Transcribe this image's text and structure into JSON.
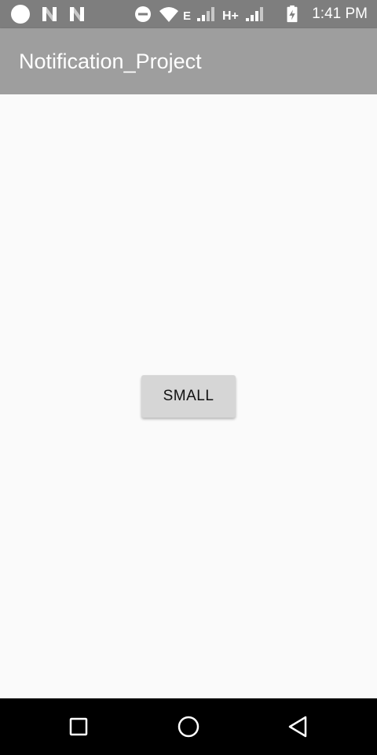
{
  "status_bar": {
    "time": "1:41 PM",
    "network_e_label": "E",
    "network_h_label": "H+",
    "icons": [
      "notification-dot-icon",
      "n-logo-icon",
      "n-logo-icon",
      "do-not-disturb-icon",
      "wifi-icon",
      "signal-icon",
      "signal-icon",
      "battery-charging-icon"
    ]
  },
  "app_bar": {
    "title": "Notification_Project"
  },
  "main": {
    "small_button_label": "SMALL"
  },
  "nav_bar": {
    "icons": [
      "recents-square-icon",
      "home-circle-icon",
      "back-triangle-icon"
    ]
  },
  "colors": {
    "status_bar": "#7e7e7e",
    "app_bar": "#9e9e9e",
    "background": "#fafafa",
    "button": "#d6d6d6",
    "nav_bar": "#000000"
  }
}
